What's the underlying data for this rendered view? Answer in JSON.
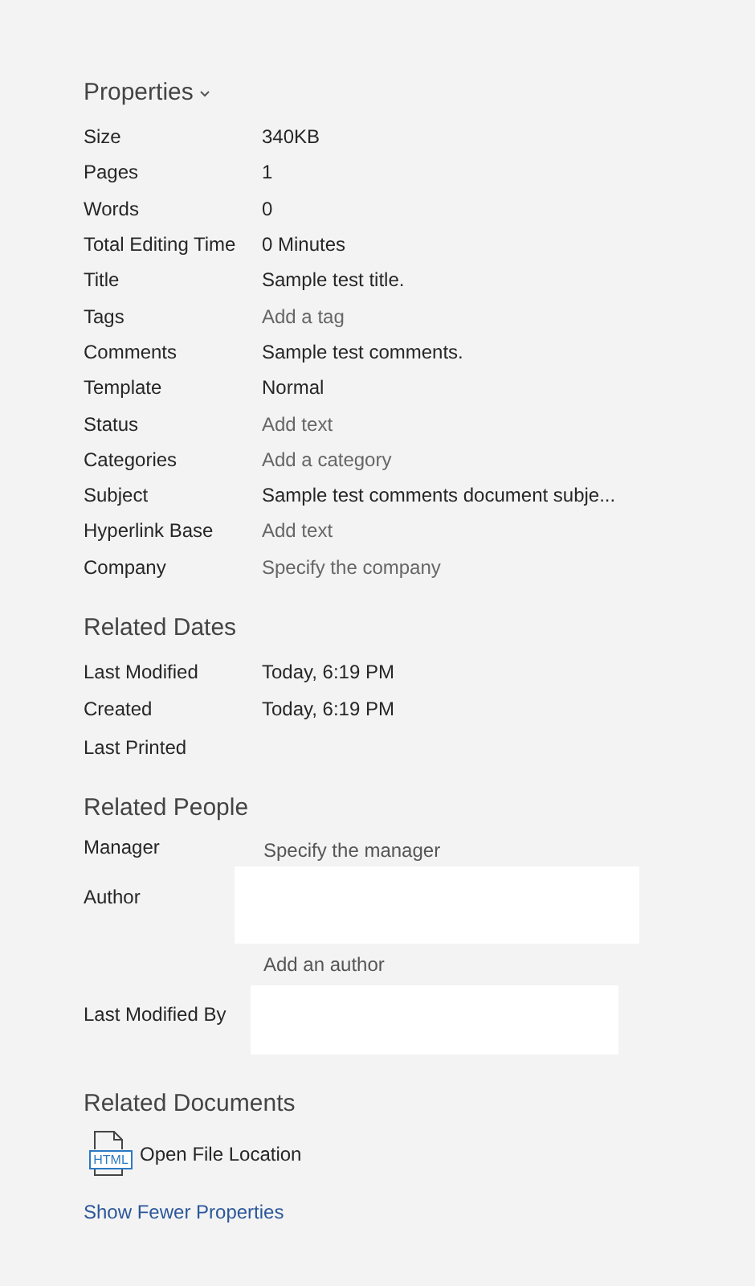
{
  "properties": {
    "title": "Properties",
    "expanded": true,
    "rows": [
      {
        "label": "Size",
        "value": "340KB",
        "kind": "value"
      },
      {
        "label": "Pages",
        "value": "1",
        "kind": "value"
      },
      {
        "label": "Words",
        "value": "0",
        "kind": "value"
      },
      {
        "label": "Total Editing Time",
        "value": "0 Minutes",
        "kind": "value"
      },
      {
        "label": "Title",
        "value": "Sample test title.",
        "kind": "value"
      },
      {
        "label": "Tags",
        "value": "Add a tag",
        "kind": "placeholder"
      },
      {
        "label": "Comments",
        "value": "Sample test comments.",
        "kind": "value"
      },
      {
        "label": "Template",
        "value": "Normal",
        "kind": "value"
      },
      {
        "label": "Status",
        "value": "Add text",
        "kind": "placeholder"
      },
      {
        "label": "Categories",
        "value": "Add a category",
        "kind": "placeholder"
      },
      {
        "label": "Subject",
        "value": "Sample test comments document subje...",
        "kind": "value"
      },
      {
        "label": "Hyperlink Base",
        "value": "Add text",
        "kind": "placeholder"
      },
      {
        "label": "Company",
        "value": "Specify the company",
        "kind": "placeholder"
      }
    ]
  },
  "related_dates": {
    "title": "Related Dates",
    "rows": [
      {
        "label": "Last Modified",
        "value": "Today, 6:19 PM"
      },
      {
        "label": "Created",
        "value": "Today, 6:19 PM"
      },
      {
        "label": "Last Printed"
      }
    ]
  },
  "related_people": {
    "title": "Related People",
    "manager": {
      "label": "Manager",
      "placeholder": "Specify the manager"
    },
    "author": {
      "label": "Author",
      "add_link": "Add an author"
    },
    "last_modified_by": {
      "label": "Last Modified By"
    }
  },
  "related_documents": {
    "title": "Related Documents",
    "items": [
      {
        "icon_text": "HTML",
        "label": "Open File Location"
      }
    ]
  },
  "show_fewer": "Show Fewer Properties"
}
